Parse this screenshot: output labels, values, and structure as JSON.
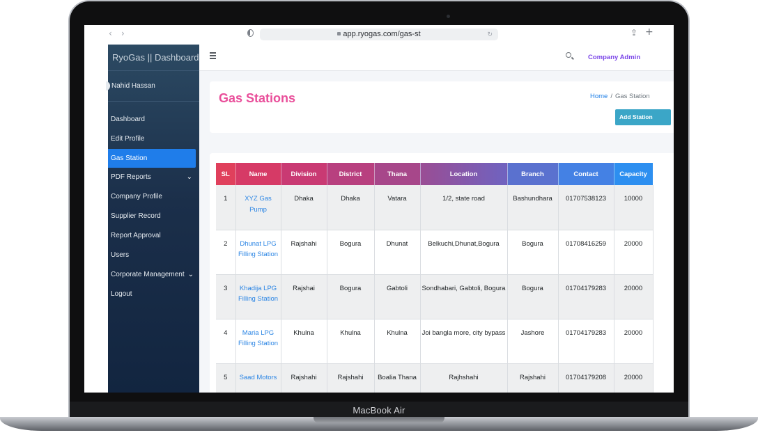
{
  "device": {
    "model_label": "MacBook Air"
  },
  "browser": {
    "back": "‹",
    "forward": "›",
    "url": "app.ryogas.com/gas-st",
    "share": "⇪",
    "new_tab": "+"
  },
  "sidebar": {
    "brand": "RyoGas || Dashboard",
    "user": "Nahid Hassan",
    "items": [
      {
        "label": "Dashboard",
        "active": false
      },
      {
        "label": "Edit Profile",
        "active": false
      },
      {
        "label": "Gas Station",
        "active": true
      },
      {
        "label": "PDF Reports",
        "active": false,
        "expandable": true
      },
      {
        "label": "Company Profile",
        "active": false
      },
      {
        "label": "Supplier Record",
        "active": false
      },
      {
        "label": "Report Approval",
        "active": false
      },
      {
        "label": "Users",
        "active": false
      },
      {
        "label": "Corporate Management",
        "active": false,
        "expandable": true
      },
      {
        "label": "Logout",
        "active": false
      }
    ],
    "chevron": "⌄"
  },
  "topbar": {
    "account": "Company Admin"
  },
  "header": {
    "title": "Gas Stations",
    "breadcrumb": {
      "home": "Home",
      "separator": "/",
      "current": "Gas Station"
    },
    "add_button": "Add Station"
  },
  "table": {
    "columns": [
      "SL",
      "Name",
      "Division",
      "District",
      "Thana",
      "Location",
      "Branch",
      "Contact",
      "Capacity"
    ],
    "rows": [
      {
        "sl": "1",
        "name": "XYZ Gas Pump",
        "division": "Dhaka",
        "district": "Dhaka",
        "thana": "Vatara",
        "location": "1/2, state road",
        "branch": "Bashundhara",
        "contact": "01707538123",
        "capacity": "10000"
      },
      {
        "sl": "2",
        "name": "Dhunat LPG Filling Station",
        "division": "Rajshahi",
        "district": "Bogura",
        "thana": "Dhunat",
        "location": "Belkuchi,Dhunat,Bogura",
        "branch": "Bogura",
        "contact": "01708416259",
        "capacity": "20000"
      },
      {
        "sl": "3",
        "name": "Khadija LPG Filling Station",
        "division": "Rajshai",
        "district": "Bogura",
        "thana": "Gabtoli",
        "location": "Sondhabari, Gabtoli, Bogura",
        "branch": "Bogura",
        "contact": "01704179283",
        "capacity": "20000"
      },
      {
        "sl": "4",
        "name": "Maria LPG Filling Station",
        "division": "Khulna",
        "district": "Khulna",
        "thana": "Khulna",
        "location": "Joi bangla more, city bypass",
        "branch": "Jashore",
        "contact": "01704179283",
        "capacity": "20000"
      },
      {
        "sl": "5",
        "name": "Saad Motors",
        "division": "Rajshahi",
        "district": "Rajshahi",
        "thana": "Boalia Thana",
        "location": "Rajhshahi",
        "branch": "Rajshahi",
        "contact": "01704179208",
        "capacity": "20000"
      }
    ]
  },
  "colors": {
    "accent_title": "#e94e9a",
    "active_menu": "#1f7dea",
    "link": "#2b85e4",
    "button": "#3ba6c7",
    "account_text": "#7a45e8"
  }
}
